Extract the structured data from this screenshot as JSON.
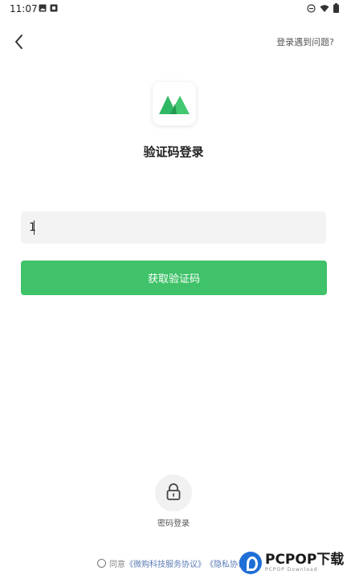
{
  "status_bar": {
    "time": "11:07"
  },
  "header": {
    "help_link": "登录遇到问题?"
  },
  "title": "验证码登录",
  "phone_input": {
    "value": "1"
  },
  "get_code_button": "获取验证码",
  "password_login": {
    "label": "密码登录"
  },
  "agreement": {
    "prefix": "同意",
    "service_link": "《微购科技服务协议》",
    "privacy_link": "《隐私协议"
  },
  "watermark": {
    "brand": "PCPOP下载",
    "sub": "PCPOP Download"
  },
  "colors": {
    "primary": "#3fc269",
    "link": "#5b7bb5"
  }
}
